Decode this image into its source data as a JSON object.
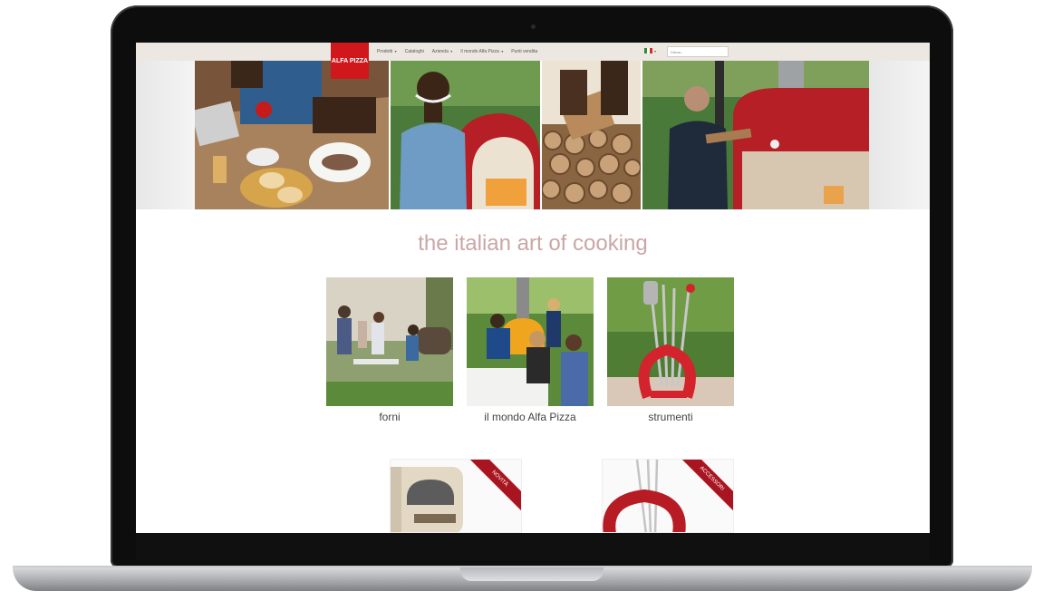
{
  "nav": {
    "logo": "ALFA PIZZA",
    "items": [
      {
        "label": "Prodotti",
        "caret": "▾"
      },
      {
        "label": "Cataloghi",
        "caret": ""
      },
      {
        "label": "Azienda",
        "caret": "▾"
      },
      {
        "label": "Il mondo Alfa Pizza",
        "caret": "▾"
      },
      {
        "label": "Punti vendita",
        "caret": ""
      }
    ],
    "language_caret": "▾",
    "search_placeholder": "Cerca..."
  },
  "hero": {
    "tagline": "the italian art of cooking"
  },
  "categories": [
    {
      "label": "forni"
    },
    {
      "label": "il mondo Alfa Pizza"
    },
    {
      "label": "strumenti"
    }
  ],
  "promos": [
    {
      "ribbon": "NOVITÀ"
    },
    {
      "ribbon": "ACCESSORI"
    }
  ],
  "colors": {
    "brand_red": "#d0181c",
    "navbar_bg": "#ece7e1",
    "tagline": "#c9a7a6",
    "ribbon": "#a81520"
  }
}
